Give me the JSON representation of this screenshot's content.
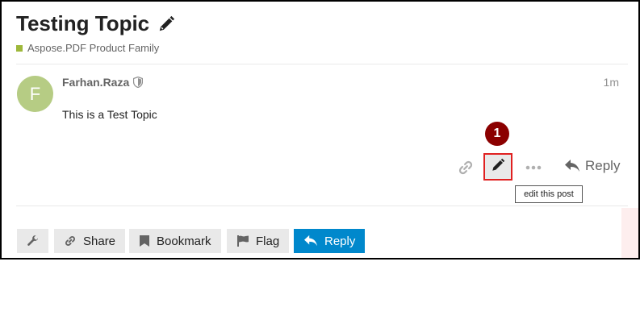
{
  "topic": {
    "title": "Testing Topic",
    "category": "Aspose.PDF Product Family",
    "category_color": "#9eb83b"
  },
  "post": {
    "avatar_letter": "F",
    "avatar_color": "#b6cc84",
    "username": "Farhan.Raza",
    "time": "1m",
    "body": "This is a Test Topic",
    "actions": {
      "reply_label": "Reply",
      "edit_tooltip": "edit this post"
    }
  },
  "annotation": {
    "step_number": "1",
    "highlight_color": "#e02020",
    "badge_color": "#8b0000"
  },
  "footer": {
    "buttons": [
      {
        "icon": "wrench-icon",
        "label": ""
      },
      {
        "icon": "link-icon",
        "label": "Share"
      },
      {
        "icon": "bookmark-icon",
        "label": "Bookmark"
      },
      {
        "icon": "flag-icon",
        "label": "Flag"
      },
      {
        "icon": "reply-icon",
        "label": "Reply"
      }
    ],
    "primary_color": "#0088cc"
  },
  "icons": {
    "title_edit": "pencil-icon",
    "user_badge": "shield-icon",
    "copy_link": "link-icon",
    "edit": "pencil-icon",
    "more": "ellipsis-icon",
    "reply": "reply-icon"
  }
}
